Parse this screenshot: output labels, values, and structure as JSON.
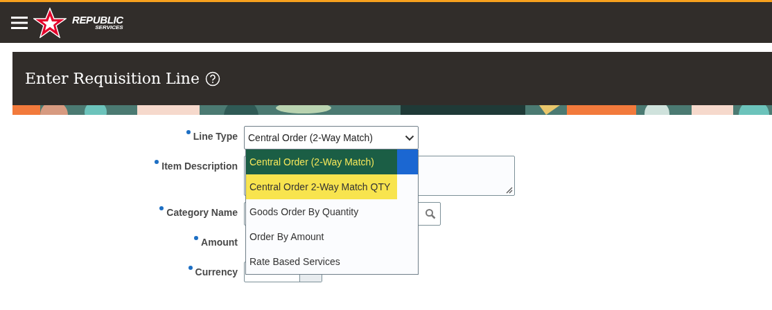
{
  "header": {
    "logo_text": "REPUBLIC",
    "logo_subtext": "SERVICES"
  },
  "page": {
    "title": "Enter Requisition Line"
  },
  "form": {
    "fields": [
      {
        "label": "Line Type",
        "required": true,
        "kind": "select",
        "value": "Central Order (2-Way Match)"
      },
      {
        "label": "Item Description",
        "required": true,
        "kind": "textarea"
      },
      {
        "label": "Category Name",
        "required": true,
        "kind": "search"
      },
      {
        "label": "Amount",
        "required": true,
        "kind": "hidden"
      },
      {
        "label": "Currency",
        "required": true,
        "kind": "choice"
      }
    ]
  },
  "dropdown": {
    "options": [
      {
        "label": "Central Order (2-Way Match)",
        "selected": true,
        "color": "#1b5e45"
      },
      {
        "label": "Central Order 2-Way Match QTY",
        "selected": false,
        "color": "#f8e44e"
      },
      {
        "label": "Goods Order By Quantity",
        "selected": false
      },
      {
        "label": "Order By Amount",
        "selected": false
      },
      {
        "label": "Rate Based Services",
        "selected": false
      }
    ]
  }
}
